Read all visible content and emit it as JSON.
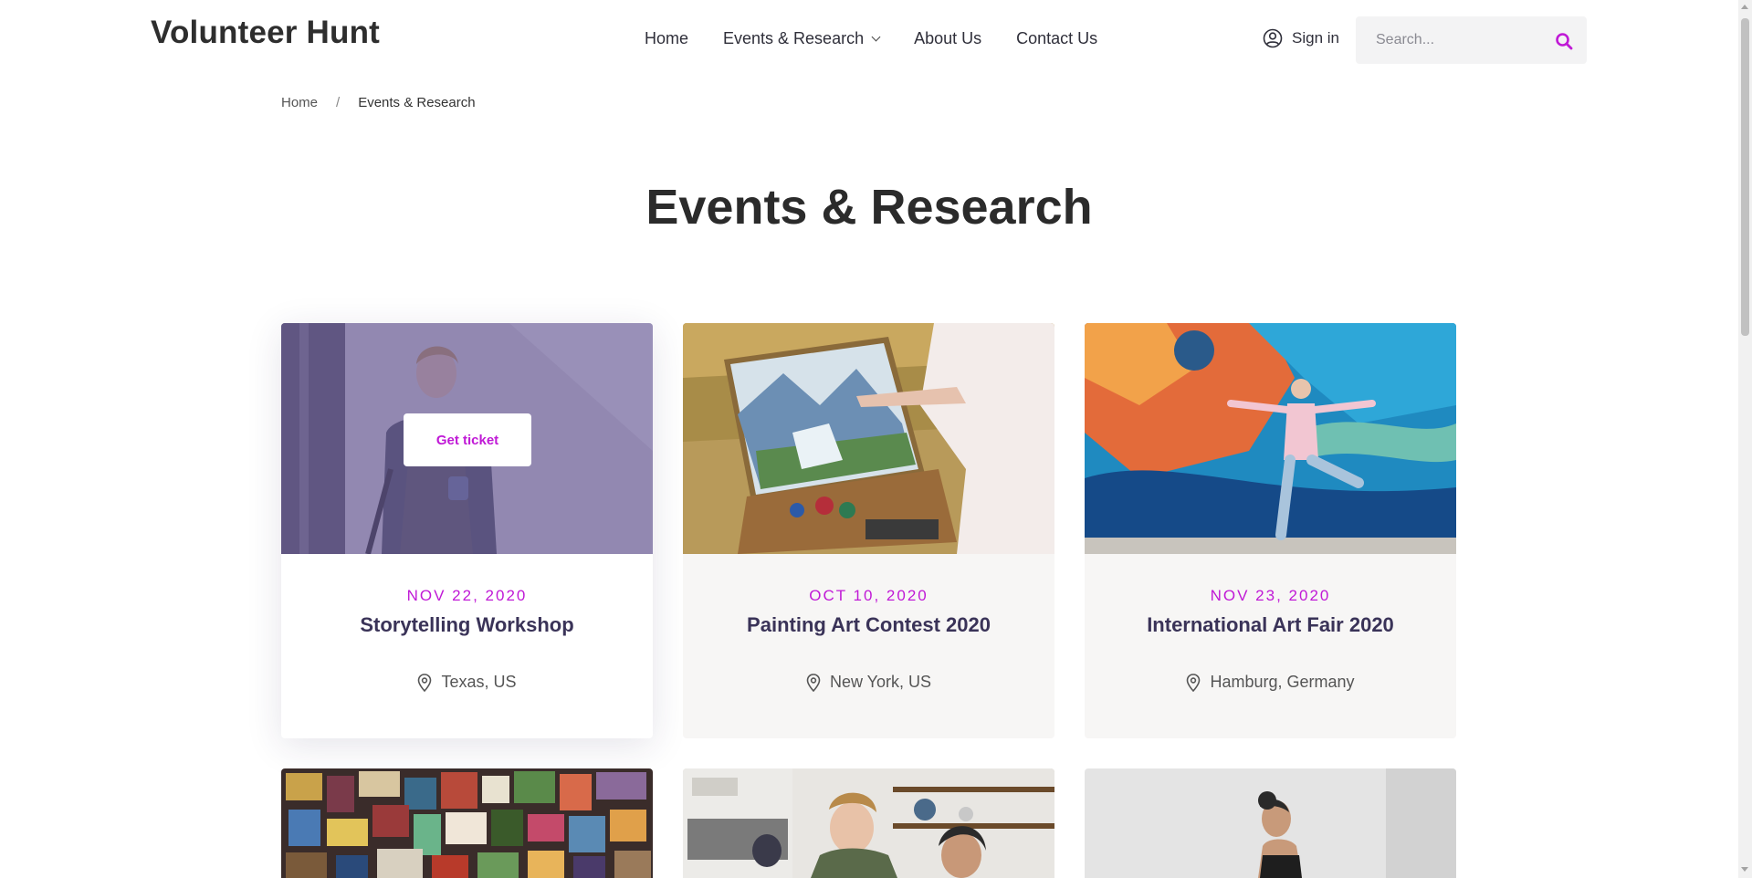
{
  "header": {
    "logo": "Volunteer Hunt",
    "nav": [
      {
        "label": "Home"
      },
      {
        "label": "Events & Research"
      },
      {
        "label": "About Us"
      },
      {
        "label": "Contact Us"
      }
    ],
    "signin_label": "Sign in",
    "search_placeholder": "Search..."
  },
  "breadcrumb": {
    "home": "Home",
    "separator": "/",
    "current": "Events & Research"
  },
  "page_title": "Events & Research",
  "colors": {
    "accent": "#c019d6",
    "title": "#3a3358",
    "card_bg": "#f7f6f5"
  },
  "events": [
    {
      "date": "NOV 22, 2020",
      "title": "Storytelling Workshop",
      "location": "Texas, US",
      "button": "Get ticket"
    },
    {
      "date": "OCT 10, 2020",
      "title": "Painting Art Contest 2020",
      "location": "New York, US"
    },
    {
      "date": "NOV 23, 2020",
      "title": "International Art Fair 2020",
      "location": "Hamburg, Germany"
    }
  ]
}
